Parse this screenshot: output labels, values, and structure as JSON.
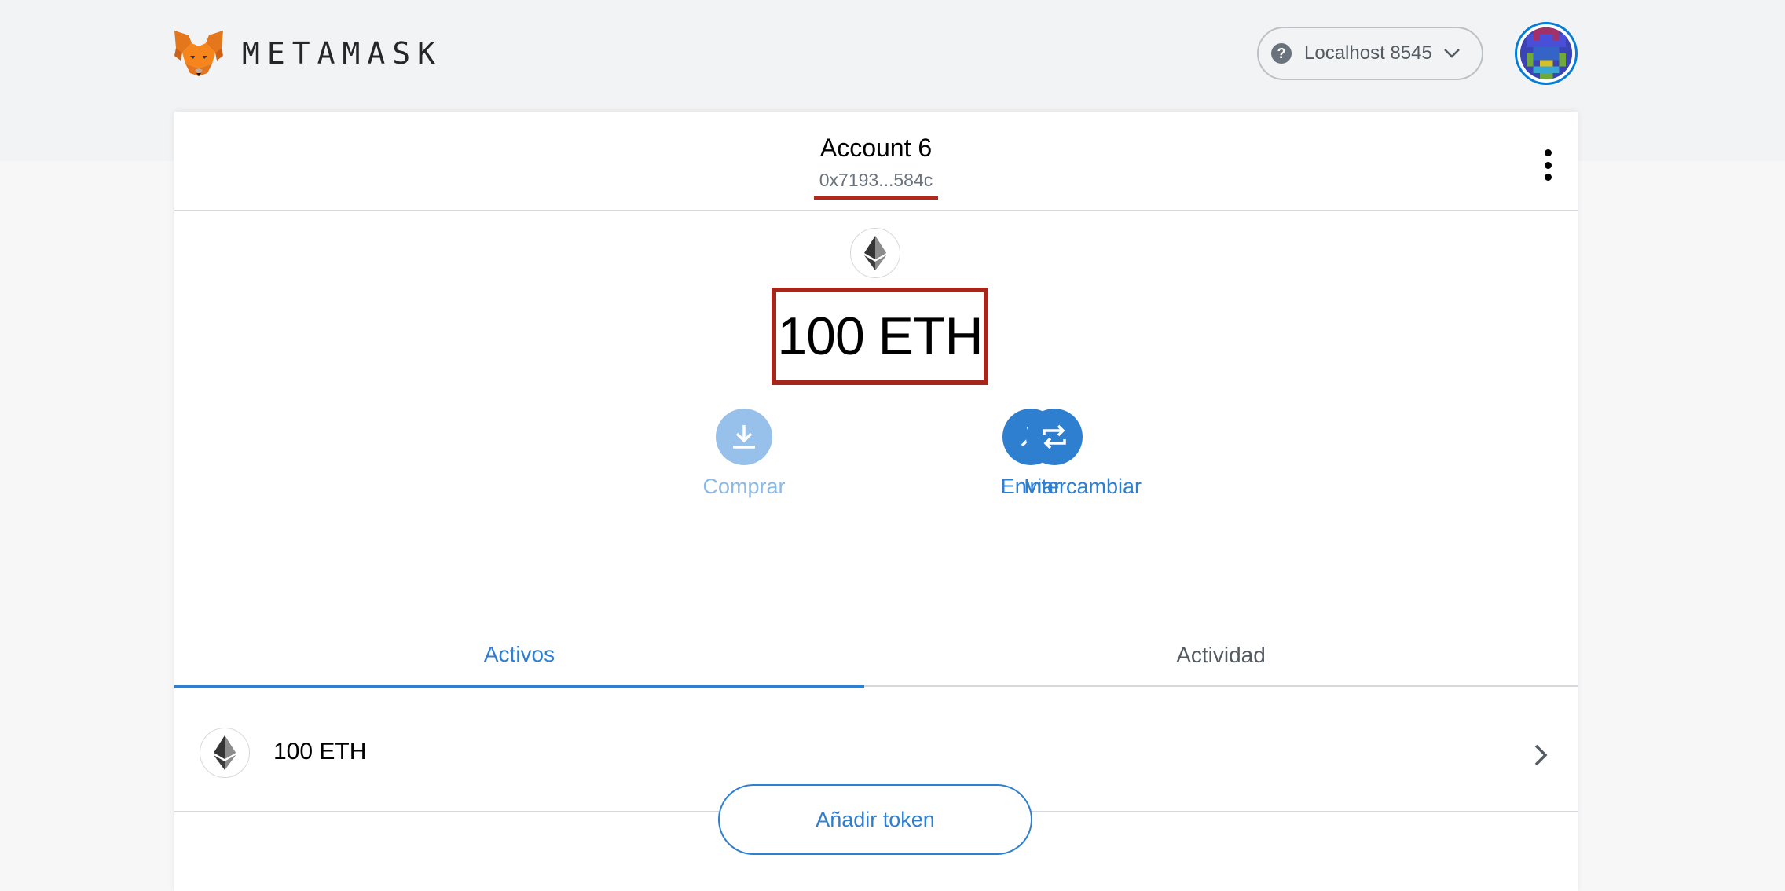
{
  "header": {
    "brand": "METAMASK",
    "network_label": "Localhost 8545",
    "network_help_glyph": "?"
  },
  "account": {
    "name": "Account 6",
    "address": "0x7193...584c"
  },
  "balance": {
    "display": "100 ETH"
  },
  "actions": [
    {
      "label": "Comprar",
      "icon": "download-icon",
      "state": "disabled"
    },
    {
      "label": "Enviar",
      "icon": "arrow-up-right-icon",
      "state": "enabled"
    },
    {
      "label": "Intercambiar",
      "icon": "swap-arrows-icon",
      "state": "enabled"
    }
  ],
  "tabs": [
    {
      "label": "Activos",
      "active": true
    },
    {
      "label": "Actividad",
      "active": false
    }
  ],
  "assets": [
    {
      "label": "100 ETH",
      "icon": "ethereum-icon"
    }
  ],
  "add_token_label": "Añadir token",
  "colors": {
    "accent": "#2f7fd1",
    "accent_disabled": "#97c0ea",
    "highlight_red": "#a5271c",
    "background": "#f2f3f4"
  }
}
